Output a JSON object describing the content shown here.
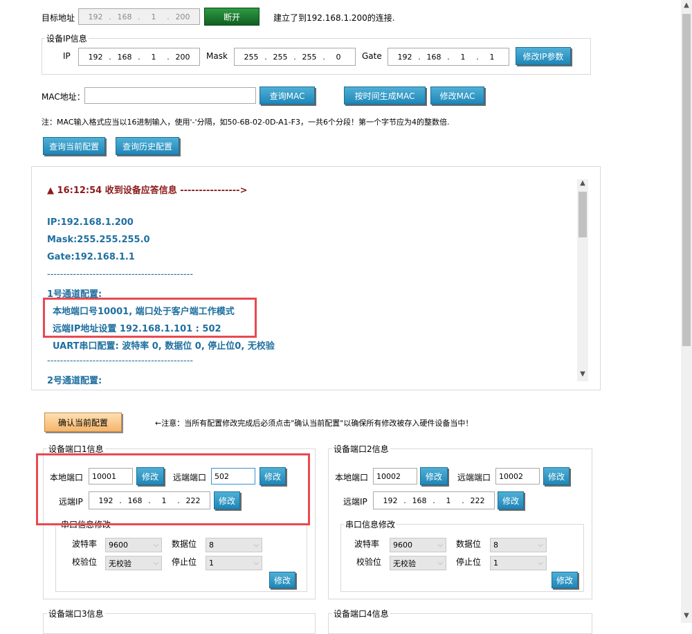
{
  "target": {
    "label": "目标地址",
    "ip": [
      "192",
      "168",
      "1",
      "200"
    ],
    "disconnect_label": "断开",
    "status": "建立了到192.168.1.200的连接."
  },
  "device_ip": {
    "group_title": "设备IP信息",
    "ip_label": "IP",
    "ip": [
      "192",
      "168",
      "1",
      "200"
    ],
    "mask_label": "Mask",
    "mask": [
      "255",
      "255",
      "255",
      "0"
    ],
    "gate_label": "Gate",
    "gate": [
      "192",
      "168",
      "1",
      "1"
    ],
    "modify_label": "修改IP参数"
  },
  "mac": {
    "label": "MAC地址：",
    "value": "",
    "query_label": "查询MAC",
    "gen_label": "按时间生成MAC",
    "modify_label": "修改MAC",
    "note": "注：MAC输入格式应当以16进制输入，使用'-'分隔，如50-6B-02-0D-A1-F3，一共6个分段！第一个字节应为4的整数倍."
  },
  "config_buttons": {
    "query_current": "查询当前配置",
    "query_history": "查询历史配置"
  },
  "log": {
    "header": "▲ 16:12:54 收到设备应答信息 ---------------->",
    "ip": "IP:192.168.1.200",
    "mask": "Mask:255.255.255.0",
    "gate": "Gate:192.168.1.1",
    "sep": "---------------------------------------------",
    "ch1_title": "1号通道配置:",
    "ch1_local": "本地端口号10001,   端口处于客户端工作模式",
    "ch1_remote": "远端IP地址设置  192.168.1.101 : 502",
    "ch1_uart": "UART串口配置: 波特率 0, 数据位 0, 停止位0, 无校验",
    "ch2_title": "2号通道配置:"
  },
  "confirm": {
    "button": "确认当前配置",
    "note": "←注意：当所有配置修改完成后必须点击\"确认当前配置\"以确保所有修改被存入硬件设备当中！"
  },
  "ports": [
    {
      "title": "设备端口1信息",
      "local_label": "本地端口",
      "local_value": "10001",
      "modify": "修改",
      "remote_port_label": "远端端口",
      "remote_port_value": "502",
      "remote_ip_label": "远端IP",
      "remote_ip": [
        "192",
        "168",
        "1",
        "222"
      ],
      "serial_title": "串口信息修改",
      "baud_label": "波特率",
      "baud_value": "9600",
      "data_label": "数据位",
      "data_value": "8",
      "parity_label": "校验位",
      "parity_value": "无校验",
      "stop_label": "停止位",
      "stop_value": "1"
    },
    {
      "title": "设备端口2信息",
      "local_label": "本地端口",
      "local_value": "10002",
      "modify": "修改",
      "remote_port_label": "远端端口",
      "remote_port_value": "10002",
      "remote_ip_label": "远端IP",
      "remote_ip": [
        "192",
        "168",
        "1",
        "222"
      ],
      "serial_title": "串口信息修改",
      "baud_label": "波特率",
      "baud_value": "9600",
      "data_label": "数据位",
      "data_value": "8",
      "parity_label": "校验位",
      "parity_value": "无校验",
      "stop_label": "停止位",
      "stop_value": "1"
    }
  ],
  "port3_title": "设备端口3信息",
  "port4_title": "设备端口4信息",
  "colors": {
    "button_blue": "#1e86b8",
    "log_text": "#1f6fa0",
    "log_header": "#8b1a1a",
    "highlight_red": "#e8494f"
  }
}
